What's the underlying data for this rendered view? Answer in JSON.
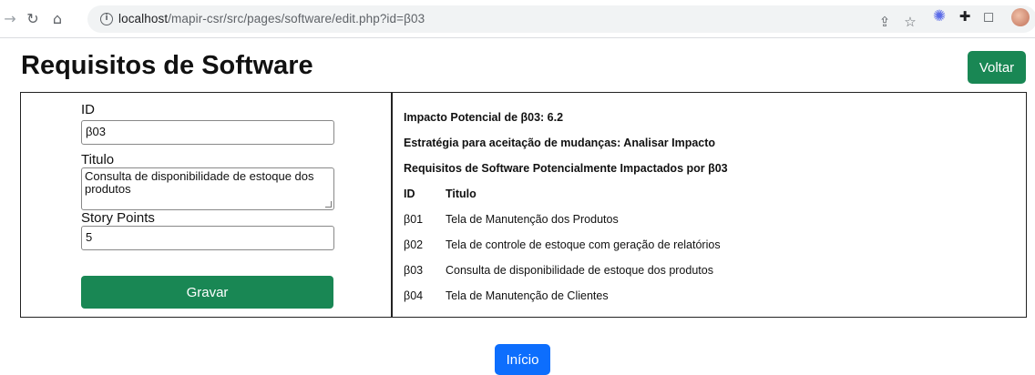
{
  "browser": {
    "url_host": "localhost",
    "url_path": "/mapir-csr/src/pages/software/edit.php?id=β03"
  },
  "page": {
    "title": "Requisitos de Software",
    "back_button": "Voltar",
    "home_button": "Início"
  },
  "form": {
    "id_label": "ID",
    "id_value": "β03",
    "title_label": "Titulo",
    "title_value": "Consulta de disponibilidade de estoque dos produtos",
    "story_points_label": "Story Points",
    "story_points_value": "5",
    "save_button": "Gravar"
  },
  "impact": {
    "potential": "Impacto Potencial de β03: 6.2",
    "strategy": "Estratégia para aceitação de mudanças: Analisar Impacto",
    "impacted_heading": "Requisitos de Software Potencialmente Impactados por β03",
    "columns": [
      "ID",
      "Titulo"
    ],
    "rows": [
      {
        "id": "β01",
        "title": "Tela de Manutenção dos Produtos"
      },
      {
        "id": "β02",
        "title": "Tela de controle de estoque com geração de relatórios"
      },
      {
        "id": "β03",
        "title": "Consulta de disponibilidade de estoque dos produtos"
      },
      {
        "id": "β04",
        "title": "Tela de Manutenção de Clientes"
      }
    ]
  },
  "colors": {
    "success": "#198754",
    "primary": "#0d6efd"
  },
  "icons": [
    "back-arrow-icon",
    "reload-icon",
    "home-icon",
    "info-icon",
    "share-icon",
    "star-icon",
    "extension-icon",
    "puzzle-icon",
    "side-panel-icon",
    "profile-avatar"
  ]
}
